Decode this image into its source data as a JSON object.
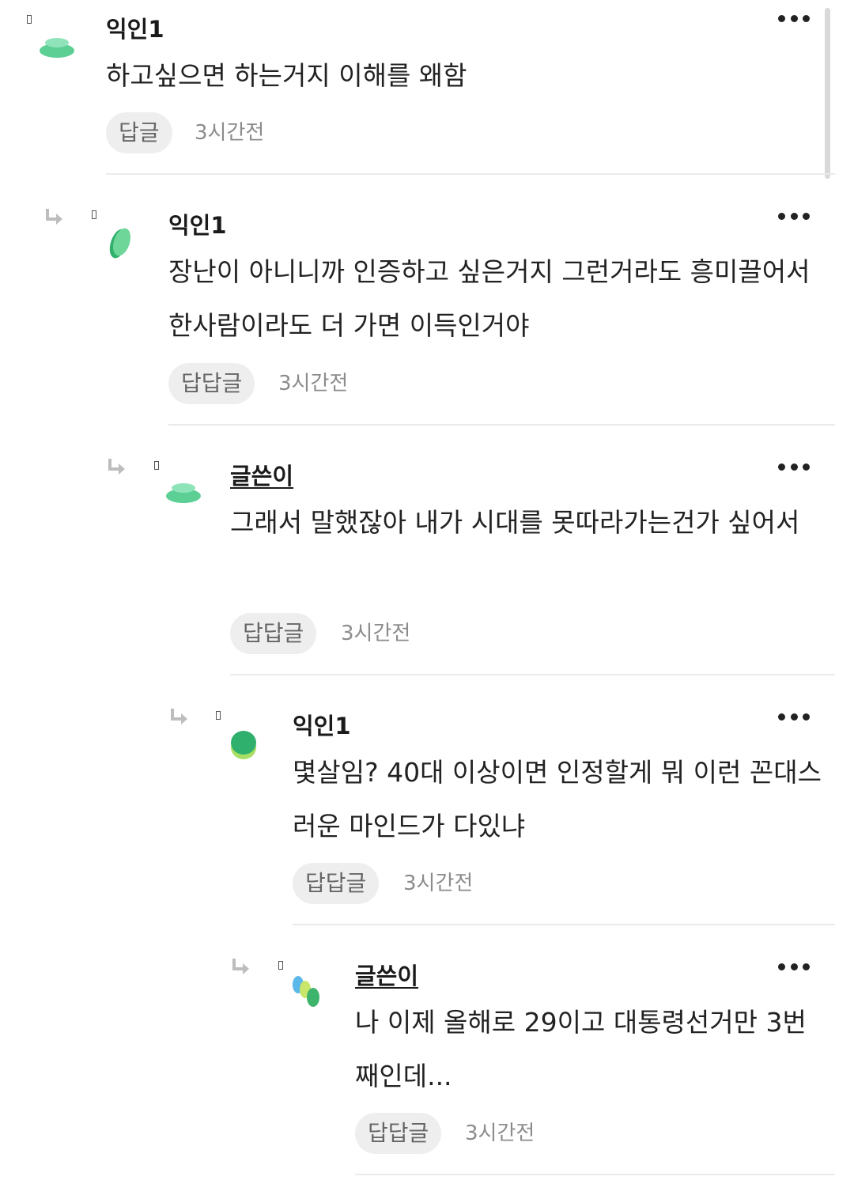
{
  "comments": [
    {
      "author": "익인1",
      "text": "하고싶으면 하는거지 이해를 왜함",
      "reply_label": "답글",
      "time": "3시간전",
      "avatar_icon": "blob-avatar-icon",
      "more_icon": "more-dots-icon"
    },
    {
      "author": "익인1",
      "text": "장난이 아니니까 인증하고 싶은거지 그런거라도 흥미끌어서 한사람이라도 더 가면 이득인거야",
      "reply_label": "답답글",
      "time": "3시간전",
      "avatar_icon": "blob-avatar-icon",
      "reply_icon": "reply-arrow-icon"
    },
    {
      "author": "글쓴이",
      "text": "그래서 말했잖아 내가 시대를 못따라가는건가 싶어서",
      "reply_label": "답답글",
      "time": "3시간전",
      "avatar_icon": "blob-avatar-icon",
      "reply_icon": "reply-arrow-icon"
    },
    {
      "author": "익인1",
      "text": "몇살임? 40대 이상이면 인정할게 뭐 이런 꼰대스러운 마인드가 다있냐",
      "reply_label": "답답글",
      "time": "3시간전",
      "avatar_icon": "blob-avatar-icon",
      "reply_icon": "reply-arrow-icon"
    },
    {
      "author": "글쓴이",
      "text": "나 이제 올해로 29이고 대통령선거만 3번째인데...",
      "reply_label": "답답글",
      "time": "3시간전",
      "avatar_icon": "blob-avatar-icon",
      "reply_icon": "reply-arrow-icon"
    }
  ],
  "colors": {
    "avatar_green": "#5ccf94",
    "avatar_lime": "#a8df64",
    "avatar_teal": "#6fd3c9",
    "avatar_blue": "#5bb8e8",
    "button_bg": "#eeeeee",
    "time_text": "#8c8c8c",
    "divider": "#eaeaea"
  }
}
